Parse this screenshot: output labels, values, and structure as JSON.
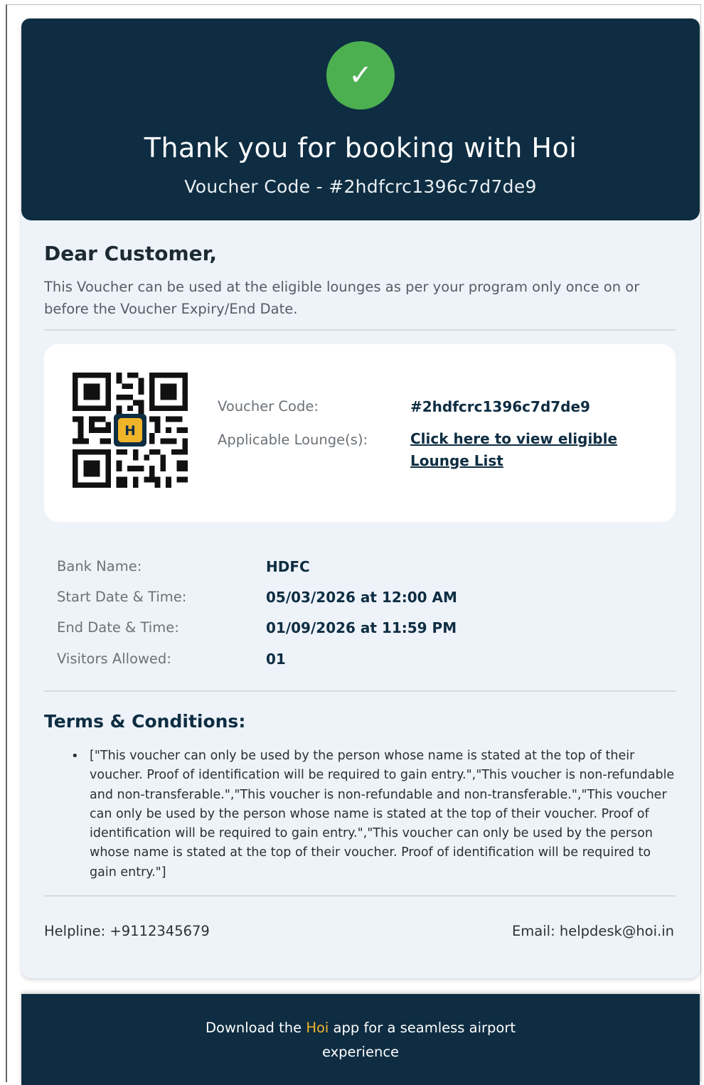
{
  "header": {
    "check_icon": "check-icon",
    "check_glyph": "✓",
    "title": "Thank you for booking with Hoi",
    "voucher_line": "Voucher Code - #2hdfcrc1396c7d7de9",
    "accent_color": "#4caf50",
    "bg_color": "#0e2d42"
  },
  "greeting": {
    "salutation": "Dear Customer,",
    "message": "This Voucher can be used at the eligible lounges as per your program only once on or before the Voucher Expiry/End Date."
  },
  "voucher_card": {
    "qr_icon": "qr-code-icon",
    "voucher_code_label": "Voucher Code:",
    "voucher_code_value": "#2hdfcrc1396c7d7de9",
    "lounge_label": "Applicable Lounge(s):",
    "lounge_link": "Click here to view eligible Lounge List"
  },
  "details": {
    "bank_label": "Bank Name:",
    "bank_value": "HDFC",
    "start_label": "Start Date & Time:",
    "start_value": "05/03/2026 at 12:00 AM",
    "end_label": "End Date & Time:",
    "end_value": "01/09/2026 at 11:59 PM",
    "visitors_label": "Visitors Allowed:",
    "visitors_value": "01"
  },
  "terms": {
    "title": "Terms & Conditions:",
    "bullet": "•",
    "text": "[\"This voucher can only be used by the person whose name is stated at the top of their voucher. Proof of identification will be required to gain entry.\",\"This voucher is non-refundable and non-transferable.\",\"This voucher is non-refundable and non-transferable.\",\"This voucher can only be used by the person whose name is stated at the top of their voucher. Proof of identification will be required to gain entry.\",\"This voucher can only be used by the person whose name is stated at the top of their voucher. Proof of identification will be required to gain entry.\"]"
  },
  "contact": {
    "helpline": "Helpline: +9112345679",
    "email": "Email: helpdesk@hoi.in"
  },
  "footer": {
    "prefix": "Download the ",
    "brand": "Hoi",
    "suffix": " app for a seamless airport",
    "line2": "experience",
    "brand_color": "#f0b429"
  }
}
